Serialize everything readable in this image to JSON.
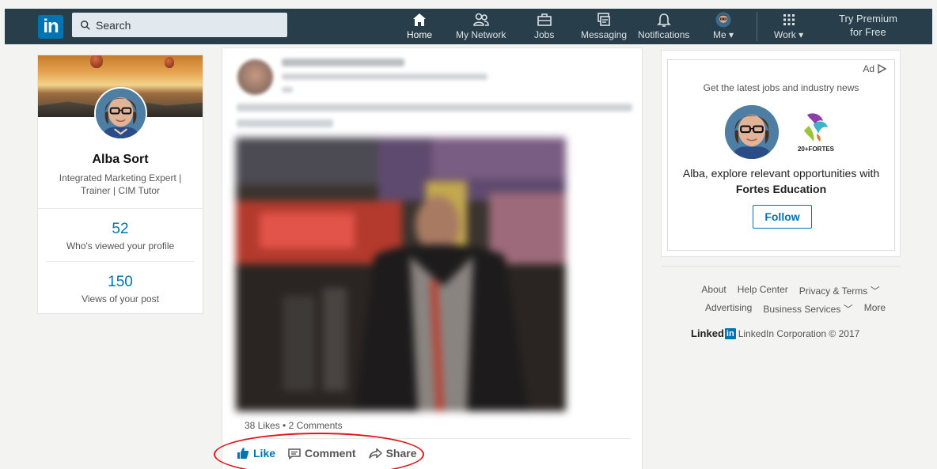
{
  "navbar": {
    "logo": "in",
    "search_placeholder": "Search",
    "items": [
      {
        "label": "Home",
        "icon": "home-icon"
      },
      {
        "label": "My Network",
        "icon": "people-icon"
      },
      {
        "label": "Jobs",
        "icon": "briefcase-icon"
      },
      {
        "label": "Messaging",
        "icon": "messaging-icon"
      },
      {
        "label": "Notifications",
        "icon": "bell-icon"
      },
      {
        "label": "Me",
        "icon": "avatar"
      },
      {
        "label": "Work",
        "icon": "grid-icon"
      }
    ],
    "premium_line1": "Try Premium",
    "premium_line2": "for Free"
  },
  "profile": {
    "name": "Alba Sort",
    "headline": "Integrated Marketing Expert | Trainer | CIM Tutor",
    "profile_views": "52",
    "profile_views_label": "Who's viewed your profile",
    "post_views": "150",
    "post_views_label": "Views of your post"
  },
  "post": {
    "likes": "38 Likes",
    "separator": "•",
    "comments": "2 Comments",
    "actions": {
      "like": "Like",
      "comment": "Comment",
      "share": "Share"
    }
  },
  "ad": {
    "label": "Ad",
    "headline": "Get the latest jobs and industry news",
    "logo_text": "20+FORTES",
    "message_prefix": "Alba, explore relevant opportunities with",
    "company": "Fortes Education",
    "follow": "Follow"
  },
  "footer": {
    "row1": [
      "About",
      "Help Center",
      "Privacy & Terms"
    ],
    "row2": [
      "Advertising",
      "Business Services",
      "More"
    ],
    "brand": "Linked",
    "brand_in": "in",
    "copyright": "LinkedIn Corporation © 2017"
  },
  "colors": {
    "nav_bg": "#283e4a",
    "brand_blue": "#0073b1",
    "highlight_red": "#e0171d"
  }
}
